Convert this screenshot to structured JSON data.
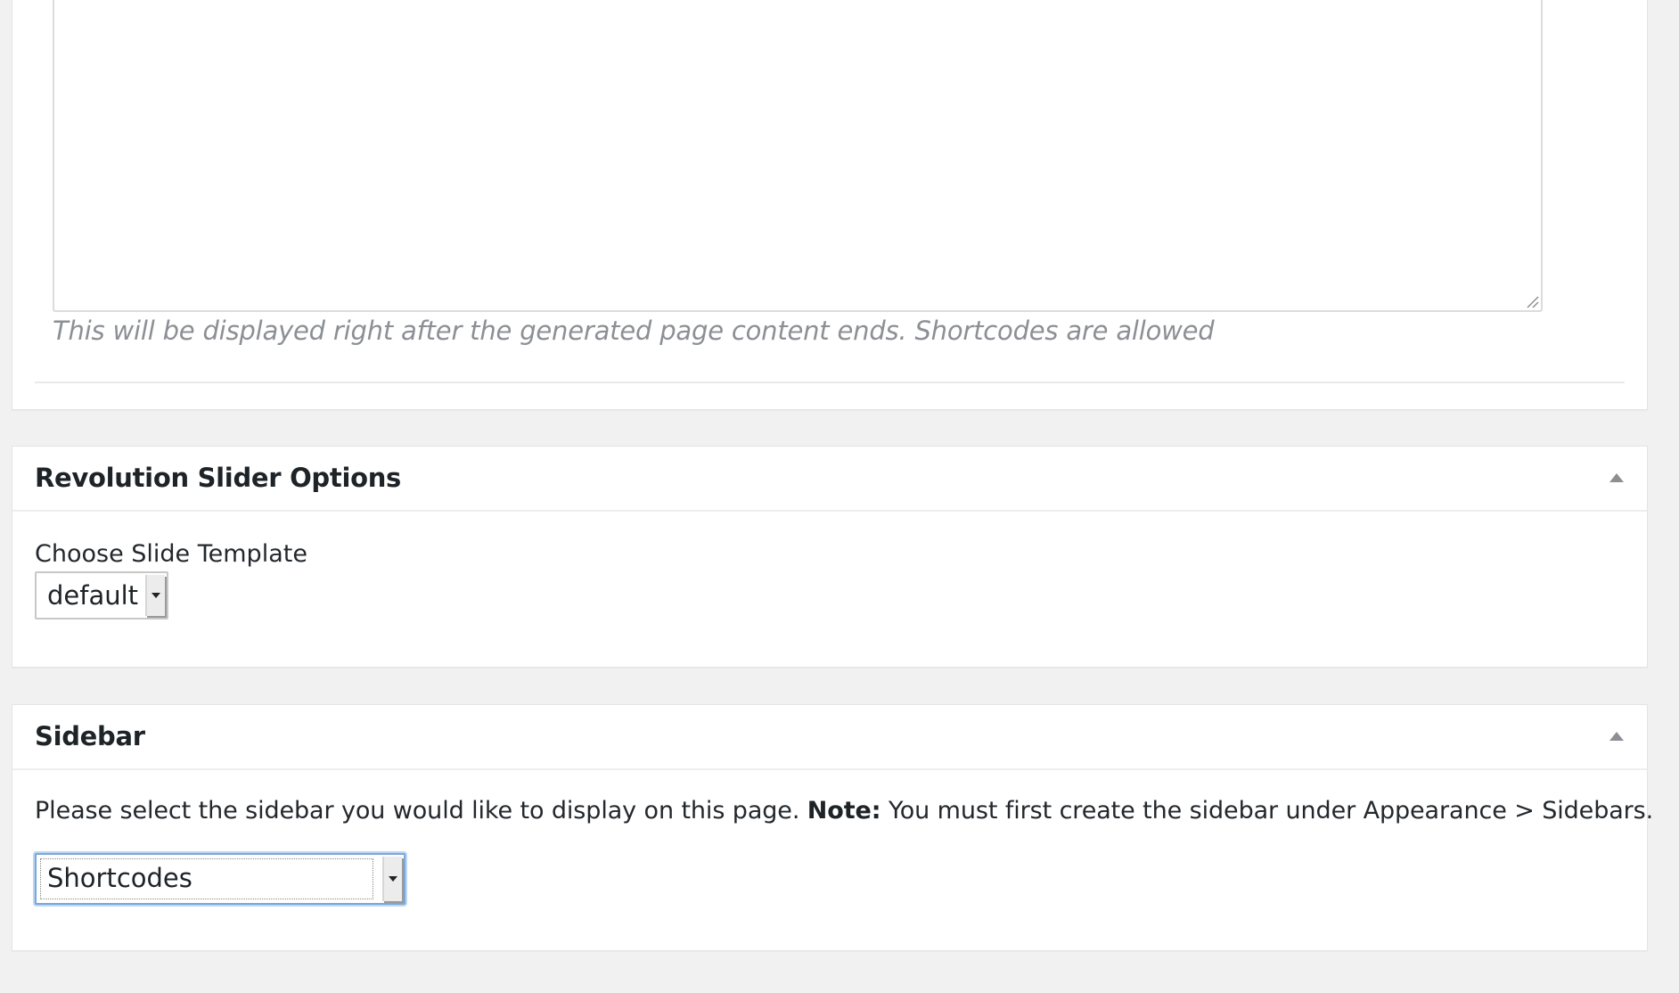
{
  "footer_content": {
    "help_text": "This will be displayed right after the generated page content ends. Shortcodes are allowed"
  },
  "revslider": {
    "title": "Revolution Slider Options",
    "field_label": "Choose Slide Template",
    "selected": "default"
  },
  "sidebar": {
    "title": "Sidebar",
    "description": "Please select the sidebar you would like to display on this page.",
    "note_label": "Note:",
    "note_text": "You must first create the sidebar under Appearance > Sidebars.",
    "selected": "Shortcodes"
  },
  "icons": {
    "collapse": "triangle-up-icon",
    "resize": "resize-grip-icon",
    "dropdown": "chevron-down-icon"
  },
  "colors": {
    "page_bg": "#f1f1f1",
    "panel_bg": "#ffffff",
    "help_text": "#8c8f94",
    "focus_ring": "#7aa7d9"
  }
}
